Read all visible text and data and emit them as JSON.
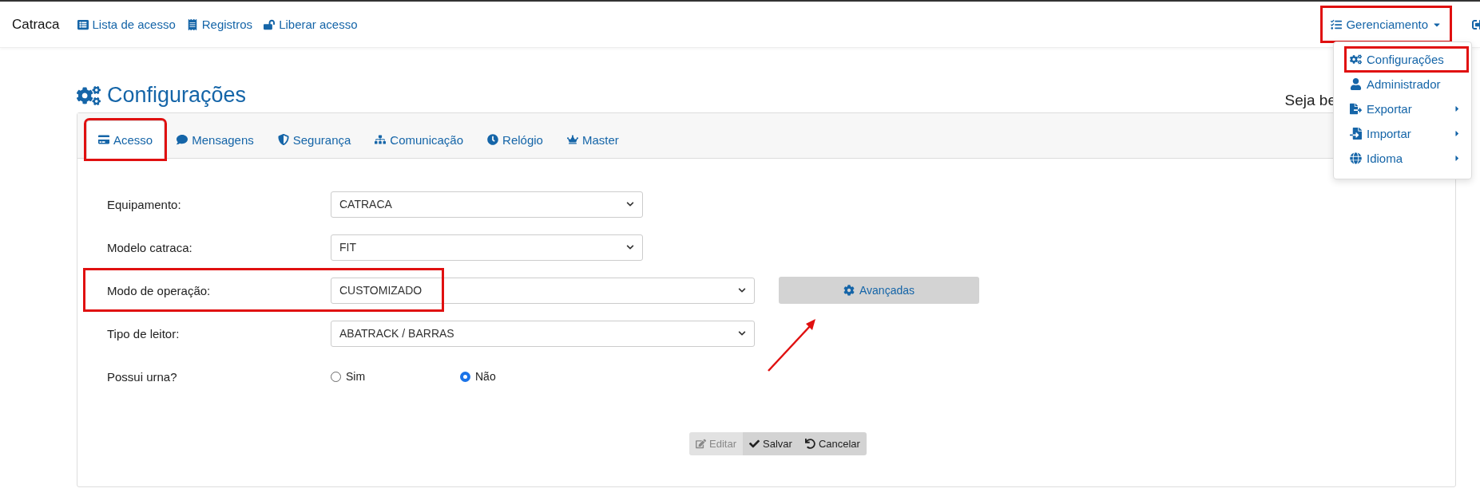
{
  "navbar": {
    "brand": "Catraca",
    "links": [
      {
        "label": "Lista de acesso"
      },
      {
        "label": "Registros"
      },
      {
        "label": "Liberar acesso"
      }
    ],
    "menu": {
      "label": "Gerenciamento",
      "expanded": true,
      "highlighted": true
    }
  },
  "dropdown": {
    "items": [
      {
        "label": "Configurações",
        "highlighted": true,
        "submenu": false
      },
      {
        "label": "Administrador",
        "highlighted": false,
        "submenu": false
      },
      {
        "label": "Exportar",
        "highlighted": false,
        "submenu": true
      },
      {
        "label": "Importar",
        "highlighted": false,
        "submenu": true
      },
      {
        "label": "Idioma",
        "highlighted": false,
        "submenu": true
      }
    ]
  },
  "page": {
    "title": "Configurações",
    "greeting": "Seja be"
  },
  "tabs": [
    {
      "label": "Acesso",
      "selected": true,
      "highlighted": true
    },
    {
      "label": "Mensagens",
      "selected": false,
      "highlighted": false
    },
    {
      "label": "Segurança",
      "selected": false,
      "highlighted": false
    },
    {
      "label": "Comunicação",
      "selected": false,
      "highlighted": false
    },
    {
      "label": "Relógio",
      "selected": false,
      "highlighted": false
    },
    {
      "label": "Master",
      "selected": false,
      "highlighted": false
    }
  ],
  "form": [
    {
      "kind": "select",
      "label": "Equipamento:",
      "value": "CATRACA",
      "wide": false,
      "highlighted": false
    },
    {
      "kind": "select",
      "label": "Modelo catraca:",
      "value": "FIT",
      "wide": false,
      "highlighted": false
    },
    {
      "kind": "select",
      "label": "Modo de operação:",
      "value": "CUSTOMIZADO",
      "wide": true,
      "highlighted": true,
      "action": "Avançadas"
    },
    {
      "kind": "select",
      "label": "Tipo de leitor:",
      "value": "ABATRACK / BARRAS",
      "wide": true,
      "highlighted": false
    },
    {
      "kind": "radio",
      "label": "Possui urna?",
      "options": [
        {
          "label": "Sim",
          "selected": false
        },
        {
          "label": "Não",
          "selected": true
        }
      ]
    }
  ],
  "buttons": [
    {
      "label": "Editar",
      "disabled": true
    },
    {
      "label": "Salvar",
      "disabled": false
    },
    {
      "label": "Cancelar",
      "disabled": false
    }
  ]
}
